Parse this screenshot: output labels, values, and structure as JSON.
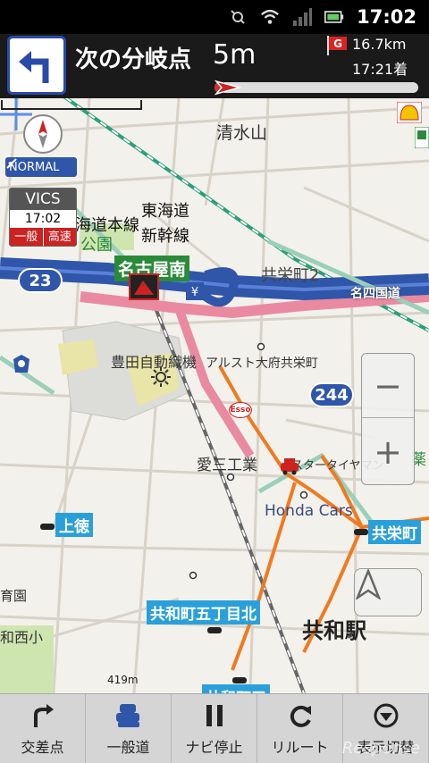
{
  "status_bar": {
    "time": "17:02"
  },
  "nav_header": {
    "next_label": "次の分岐点",
    "next_distance": "5m",
    "goal_badge": "G",
    "goal_distance": "16.7km",
    "goal_eta": "17:21着",
    "route_progress": 0.05
  },
  "overlays": {
    "mode_badge": "NORMAL",
    "vics": {
      "title": "VICS",
      "time": "17:02",
      "modes": [
        "一般",
        "高速"
      ]
    },
    "zoom_out": "−",
    "zoom_in": "+",
    "scale": "419m"
  },
  "map_labels": {
    "shimizuyama": "清水山",
    "tokaido": "東海道",
    "tokaido_honsen": "海道本線",
    "shinkansen": "新幹線",
    "koen": "公園",
    "interchange": "名古屋南",
    "route23": "23",
    "kyoeicho2": "共栄町2",
    "meishi_kokudo": "名四国道",
    "toyota_shokki": "豊田自動織機",
    "alust": "アルスト大府共栄町",
    "route244": "244",
    "aisan": "愛三工業",
    "star_tire": "スタータイヤマン",
    "honda": "Honda Cars",
    "kyoeicho": "共栄町",
    "kamitoku": "上徳",
    "ikuen": "育園",
    "nishisho": "和西小",
    "kyowa5": "共和町五丁目北",
    "kyowa_station": "共和駅",
    "kyowa_partial": "共和町五",
    "kusuri": "薬",
    "esso": "Esso"
  },
  "bottom_bar": {
    "items": [
      {
        "label": "交差点",
        "icon": "turn-arrow-icon"
      },
      {
        "label": "一般道",
        "icon": "cars-icon"
      },
      {
        "label": "ナビ停止",
        "icon": "pause-icon"
      },
      {
        "label": "リルート",
        "icon": "reroute-icon"
      },
      {
        "label": "表示切替",
        "icon": "display-toggle-icon"
      }
    ]
  },
  "watermark": "Response"
}
